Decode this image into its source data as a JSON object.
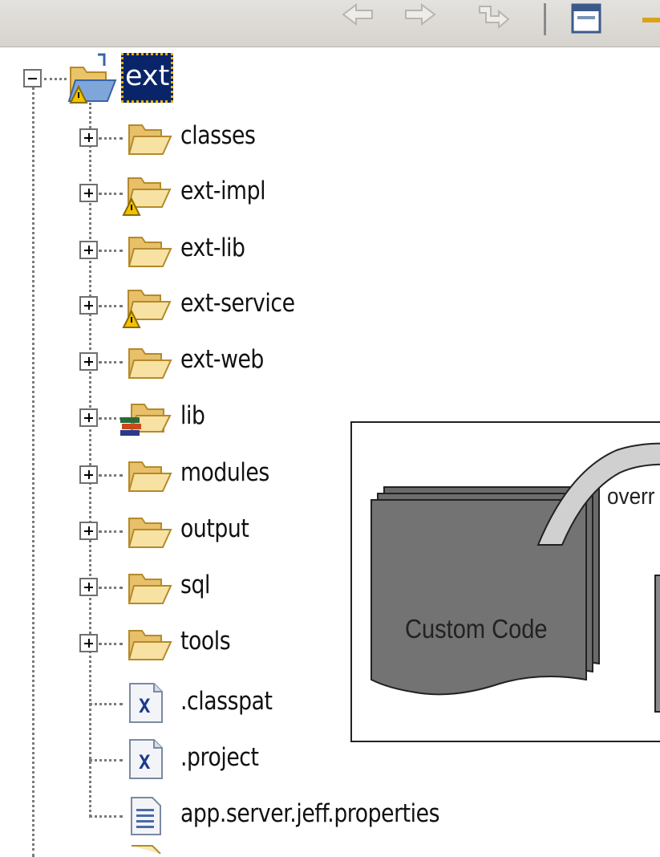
{
  "tree": {
    "root": {
      "label": "ext",
      "icon": "warning-folder-icon",
      "expanded": true,
      "selected": true
    },
    "children": [
      {
        "label": "classes",
        "icon": "folder-icon",
        "expandable": true
      },
      {
        "label": "ext-impl",
        "icon": "warning-folder-icon",
        "expandable": true
      },
      {
        "label": "ext-lib",
        "icon": "folder-icon",
        "expandable": true
      },
      {
        "label": "ext-service",
        "icon": "warning-folder-icon",
        "expandable": true
      },
      {
        "label": "ext-web",
        "icon": "folder-icon",
        "expandable": true
      },
      {
        "label": "lib",
        "icon": "library-folder-icon",
        "expandable": true
      },
      {
        "label": "modules",
        "icon": "folder-icon",
        "expandable": true
      },
      {
        "label": "output",
        "icon": "folder-icon",
        "expandable": true
      },
      {
        "label": "sql",
        "icon": "folder-icon",
        "expandable": true
      },
      {
        "label": "tools",
        "icon": "folder-icon",
        "expandable": true
      },
      {
        "label": ".classpat",
        "icon": "xml-file-icon",
        "expandable": false
      },
      {
        "label": ".project",
        "icon": "xml-file-icon",
        "expandable": false
      },
      {
        "label": "app.server.jeff.properties",
        "icon": "text-file-icon",
        "expandable": false
      }
    ]
  },
  "diagram": {
    "left_box_label": "Custom Code",
    "arrow_label": "overr"
  },
  "toolbar": {
    "icons": [
      "back-arrow-icon",
      "forward-arrow-icon",
      "up-icon",
      "window-icon",
      "pin-icon"
    ]
  }
}
